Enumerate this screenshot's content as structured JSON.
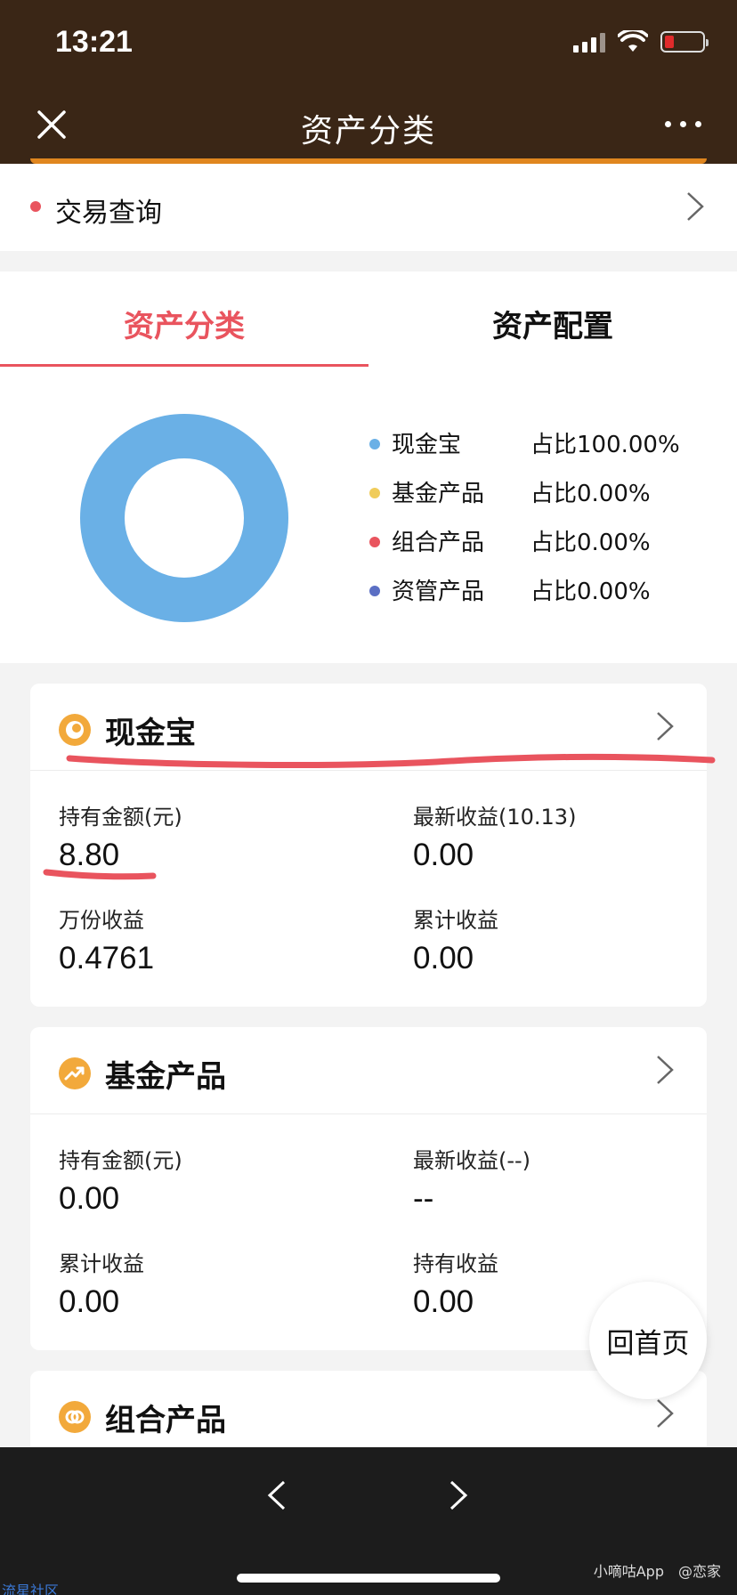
{
  "status_bar": {
    "time": "13:21"
  },
  "nav": {
    "title": "资产分类"
  },
  "trade_query": {
    "label": "交易查询"
  },
  "tabs": [
    {
      "label": "资产分类",
      "active": true
    },
    {
      "label": "资产配置",
      "active": false
    }
  ],
  "allocation": {
    "legend": [
      {
        "name": "现金宝",
        "pct": "占比100.00%",
        "color": "#6ab0e6"
      },
      {
        "name": "基金产品",
        "pct": "占比0.00%",
        "color": "#f0cc5a"
      },
      {
        "name": "组合产品",
        "pct": "占比0.00%",
        "color": "#e9545e"
      },
      {
        "name": "资管产品",
        "pct": "占比0.00%",
        "color": "#5b6fc4"
      }
    ]
  },
  "cards": [
    {
      "title": "现金宝",
      "icon": "cash-treasure-icon",
      "metrics": [
        {
          "label": "持有金额(元)",
          "value": "8.80"
        },
        {
          "label": "最新收益(10.13)",
          "value": "0.00"
        },
        {
          "label": "万份收益",
          "value": "0.4761"
        },
        {
          "label": "累计收益",
          "value": "0.00"
        }
      ]
    },
    {
      "title": "基金产品",
      "icon": "trend-up-icon",
      "metrics": [
        {
          "label": "持有金额(元)",
          "value": "0.00"
        },
        {
          "label": "最新收益(--)",
          "value": "--"
        },
        {
          "label": "累计收益",
          "value": "0.00"
        },
        {
          "label": "持有收益",
          "value": "0.00"
        }
      ]
    },
    {
      "title": "组合产品",
      "icon": "link-icon"
    }
  ],
  "home_button": {
    "label": "回首页"
  },
  "watermarks": {
    "left": "流星社区",
    "right": "小嘀咕App　@恋家"
  },
  "colors": {
    "accent": "#e9545e",
    "header_bg": "#3a2616",
    "donut": "#6ab0e6",
    "icon": "#f2a93b"
  }
}
